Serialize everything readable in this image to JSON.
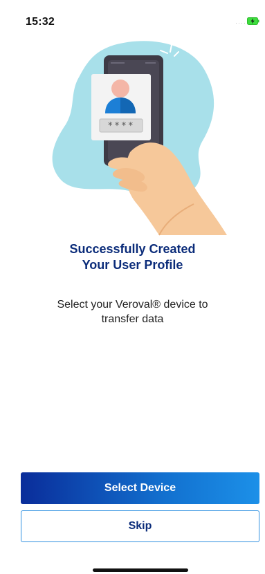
{
  "status_bar": {
    "time": "15:32",
    "signal_dots": "····",
    "battery_icon": "charging-battery-icon",
    "battery_color": "#3ddc3d"
  },
  "illustration": {
    "icon": "phone-in-hand-user-profile-illustration",
    "pin_masked": "****",
    "blob_color": "#a8e0ea",
    "phone_color": "#3d3a45",
    "hand_color": "#f6c89a"
  },
  "title": {
    "line1": "Successfully Created",
    "line2": "Your User Profile"
  },
  "subtitle": {
    "line1": "Select your Veroval® device to",
    "line2": "transfer data"
  },
  "buttons": {
    "select_device": "Select Device",
    "skip": "Skip"
  },
  "colors": {
    "title": "#0b2c7a",
    "primary_gradient_start": "#0a2d9a",
    "primary_gradient_end": "#1c90e8",
    "secondary_border": "#2d8fe0"
  }
}
